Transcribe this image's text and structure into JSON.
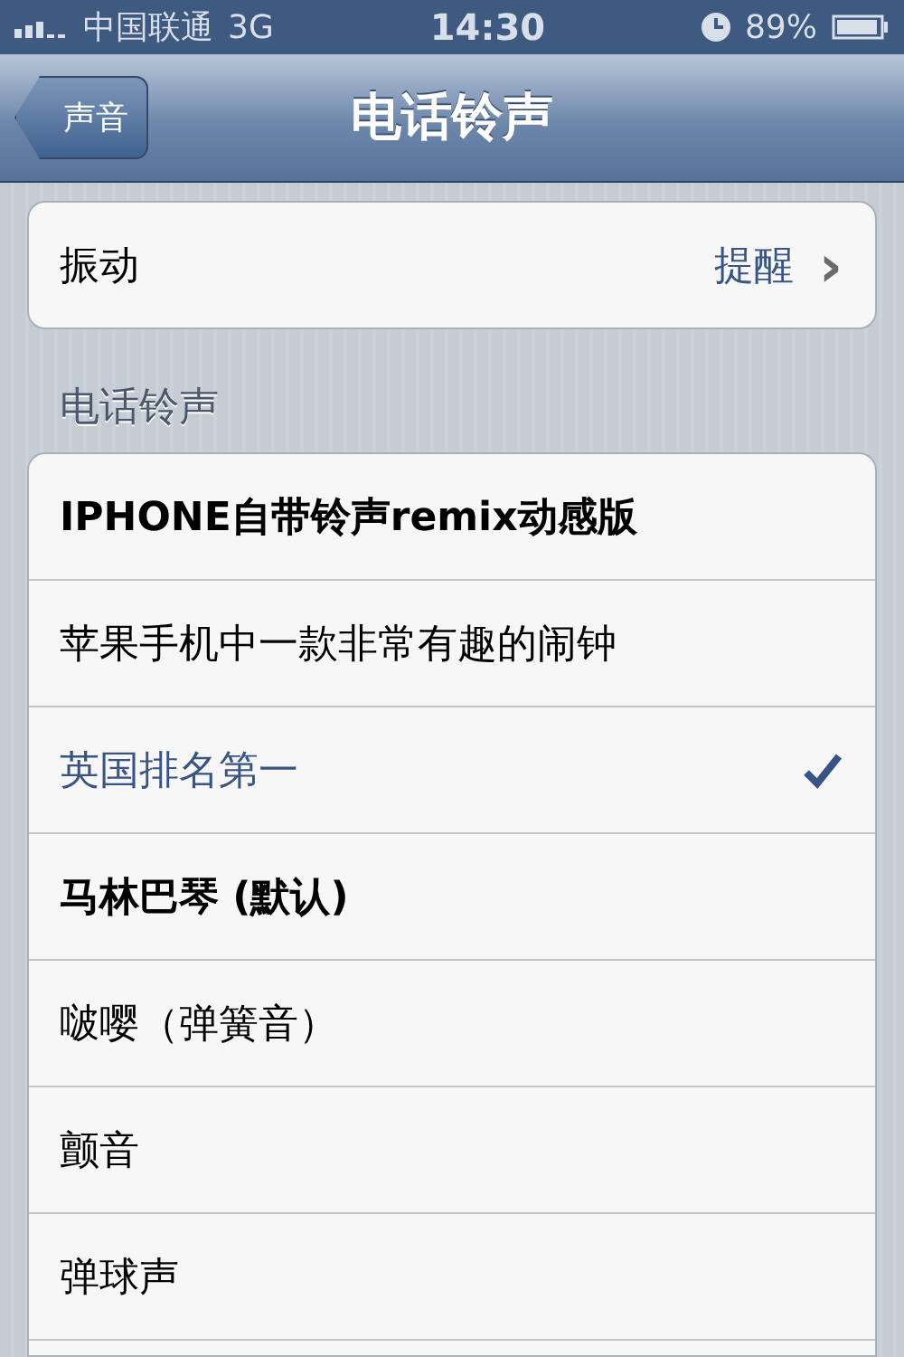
{
  "status_bar": {
    "carrier": "中国联通",
    "network": "3G",
    "time": "14:30",
    "battery": "89%"
  },
  "nav_bar": {
    "back_button": "声音",
    "title": "电话铃声"
  },
  "vibration": {
    "label": "振动",
    "value": "提醒",
    "chevron": "›"
  },
  "section_header": "电话铃声",
  "ringtones": [
    {
      "name": "IPHONE自带铃声remix动感版",
      "bold": true,
      "selected": false
    },
    {
      "name": "苹果手机中一款非常有趣的闹钟",
      "bold": false,
      "selected": false
    },
    {
      "name": "英国排名第一",
      "bold": false,
      "selected": true
    },
    {
      "name": "马林巴琴 (默认)",
      "bold": true,
      "selected": false
    },
    {
      "name": "啵嘤（弹簧音）",
      "bold": false,
      "selected": false
    },
    {
      "name": "颤音",
      "bold": false,
      "selected": false
    },
    {
      "name": "弹球声",
      "bold": false,
      "selected": false
    }
  ]
}
